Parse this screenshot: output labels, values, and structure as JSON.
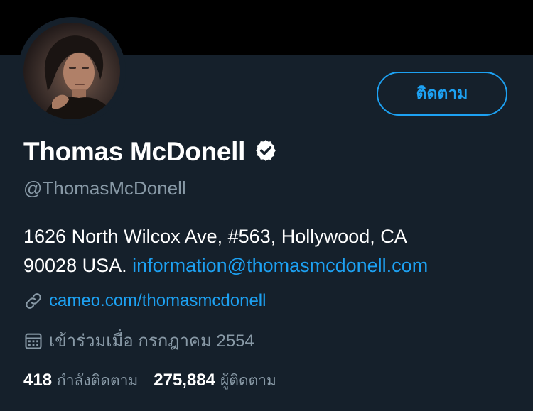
{
  "profile": {
    "follow_label": "ติดตาม",
    "display_name": "Thomas McDonell",
    "handle": "@ThomasMcDonell",
    "bio_line1": "1626 North Wilcox Ave, #563, Hollywood, CA",
    "bio_line2_text": "90028 USA. ",
    "bio_email": "information@thomasmcdonell.com",
    "website": "cameo.com/thomasmcdonell",
    "joined": "เข้าร่วมเมื่อ กรกฎาคม 2554",
    "following_count": "418",
    "following_label": "กำลังติดตาม",
    "followers_count": "275,884",
    "followers_label": "ผู้ติดตาม"
  },
  "icons": {
    "verified": "verified-badge-icon",
    "link": "link-icon",
    "calendar": "calendar-icon"
  },
  "colors": {
    "background": "#15202b",
    "banner": "#000000",
    "accent": "#1da1f2",
    "secondary_text": "#8899a6",
    "primary_text": "#ffffff"
  }
}
